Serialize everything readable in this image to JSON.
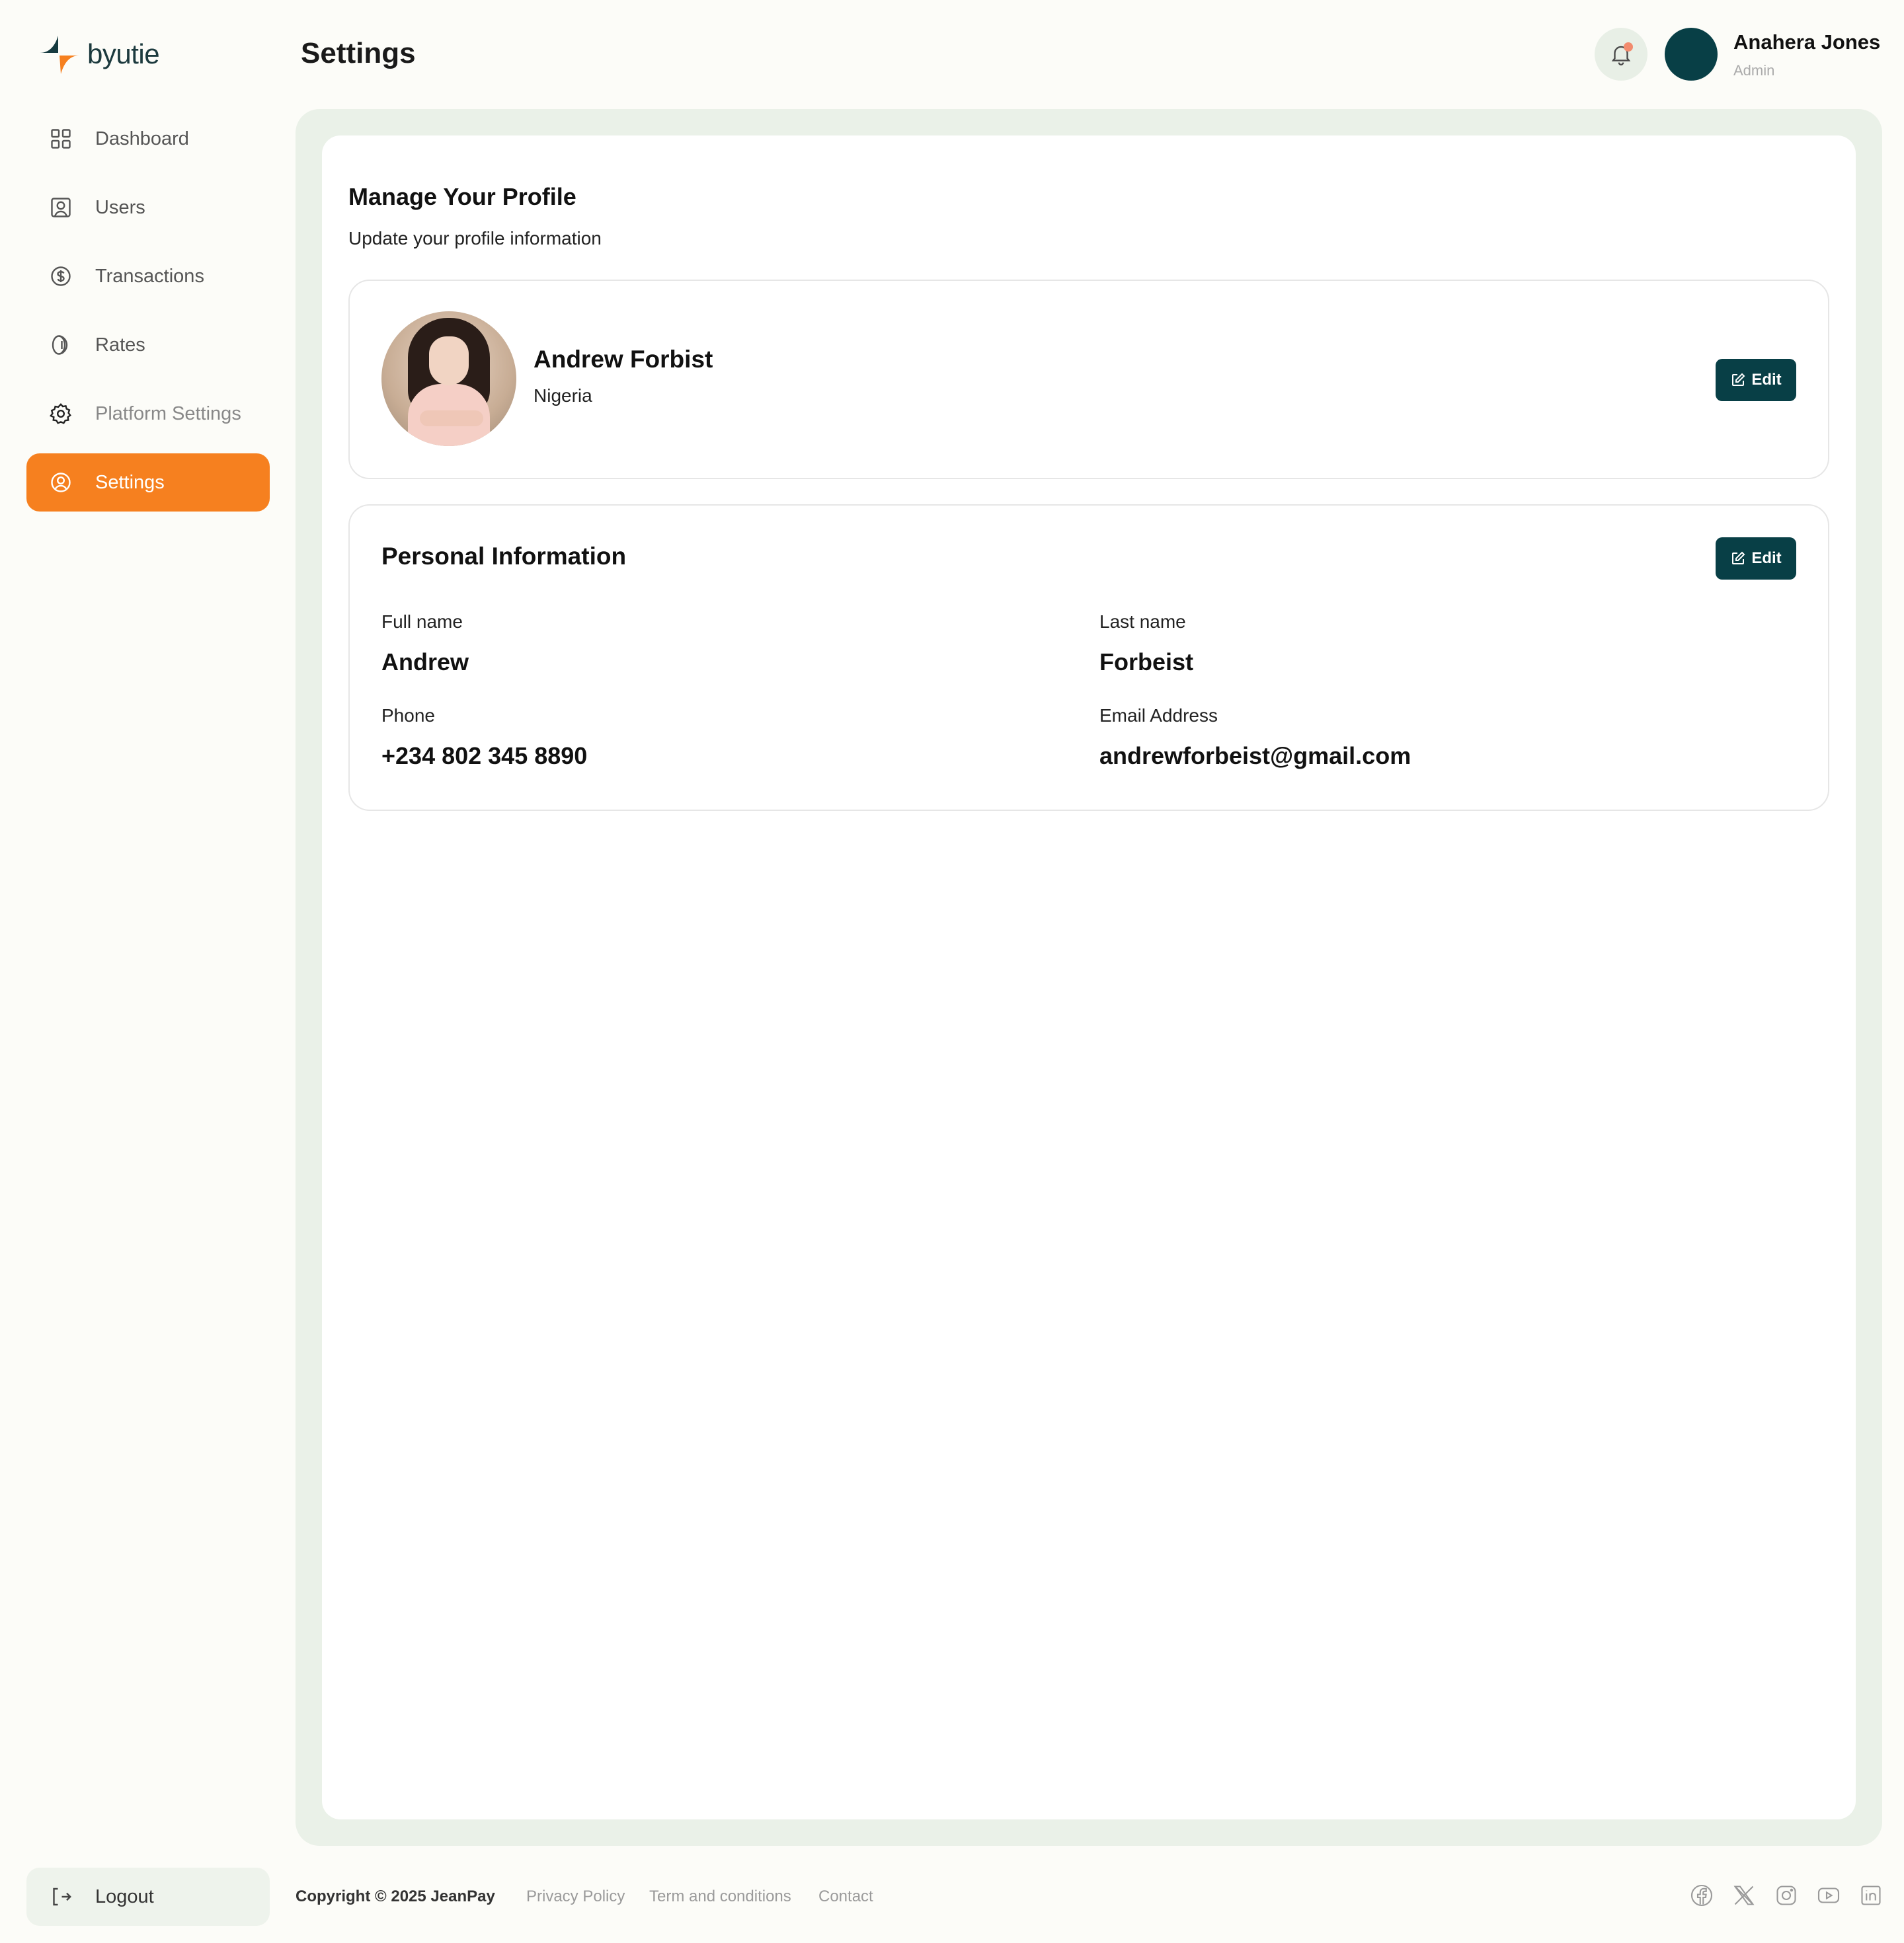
{
  "brand": {
    "name": "byutie"
  },
  "sidebar": {
    "items": [
      {
        "label": "Dashboard",
        "icon": "grid-icon"
      },
      {
        "label": "Users",
        "icon": "user-square-icon"
      },
      {
        "label": "Transactions",
        "icon": "dollar-circle-icon"
      },
      {
        "label": "Rates",
        "icon": "coin-icon"
      },
      {
        "label": "Platform Settings",
        "icon": "gear-icon"
      },
      {
        "label": "Settings",
        "icon": "user-circle-icon"
      }
    ],
    "active": "Settings",
    "logout_label": "Logout"
  },
  "header": {
    "title": "Settings",
    "user_name": "Anahera Jones",
    "user_role": "Admin"
  },
  "main": {
    "heading": "Manage Your Profile",
    "subheading": "Update your profile information",
    "profile": {
      "name": "Andrew Forbist",
      "country": "Nigeria",
      "edit_label": "Edit"
    },
    "personal": {
      "title": "Personal Information",
      "edit_label": "Edit",
      "full_name_label": "Full name",
      "full_name": "Andrew",
      "last_name_label": "Last name",
      "last_name": "Forbeist",
      "phone_label": "Phone",
      "phone": "+234 802 345 8890",
      "email_label": "Email Address",
      "email": "andrewforbeist@gmail.com"
    }
  },
  "footer": {
    "copyright": "Copyright © 2025 JeanPay",
    "links": [
      "Privacy Policy",
      "Term and conditions",
      "Contact"
    ],
    "social": [
      "facebook-icon",
      "x-icon",
      "instagram-icon",
      "youtube-icon",
      "linkedin-icon"
    ]
  },
  "colors": {
    "accent": "#F6801F",
    "primary": "#083F46",
    "frame": "#EAF1E8"
  }
}
